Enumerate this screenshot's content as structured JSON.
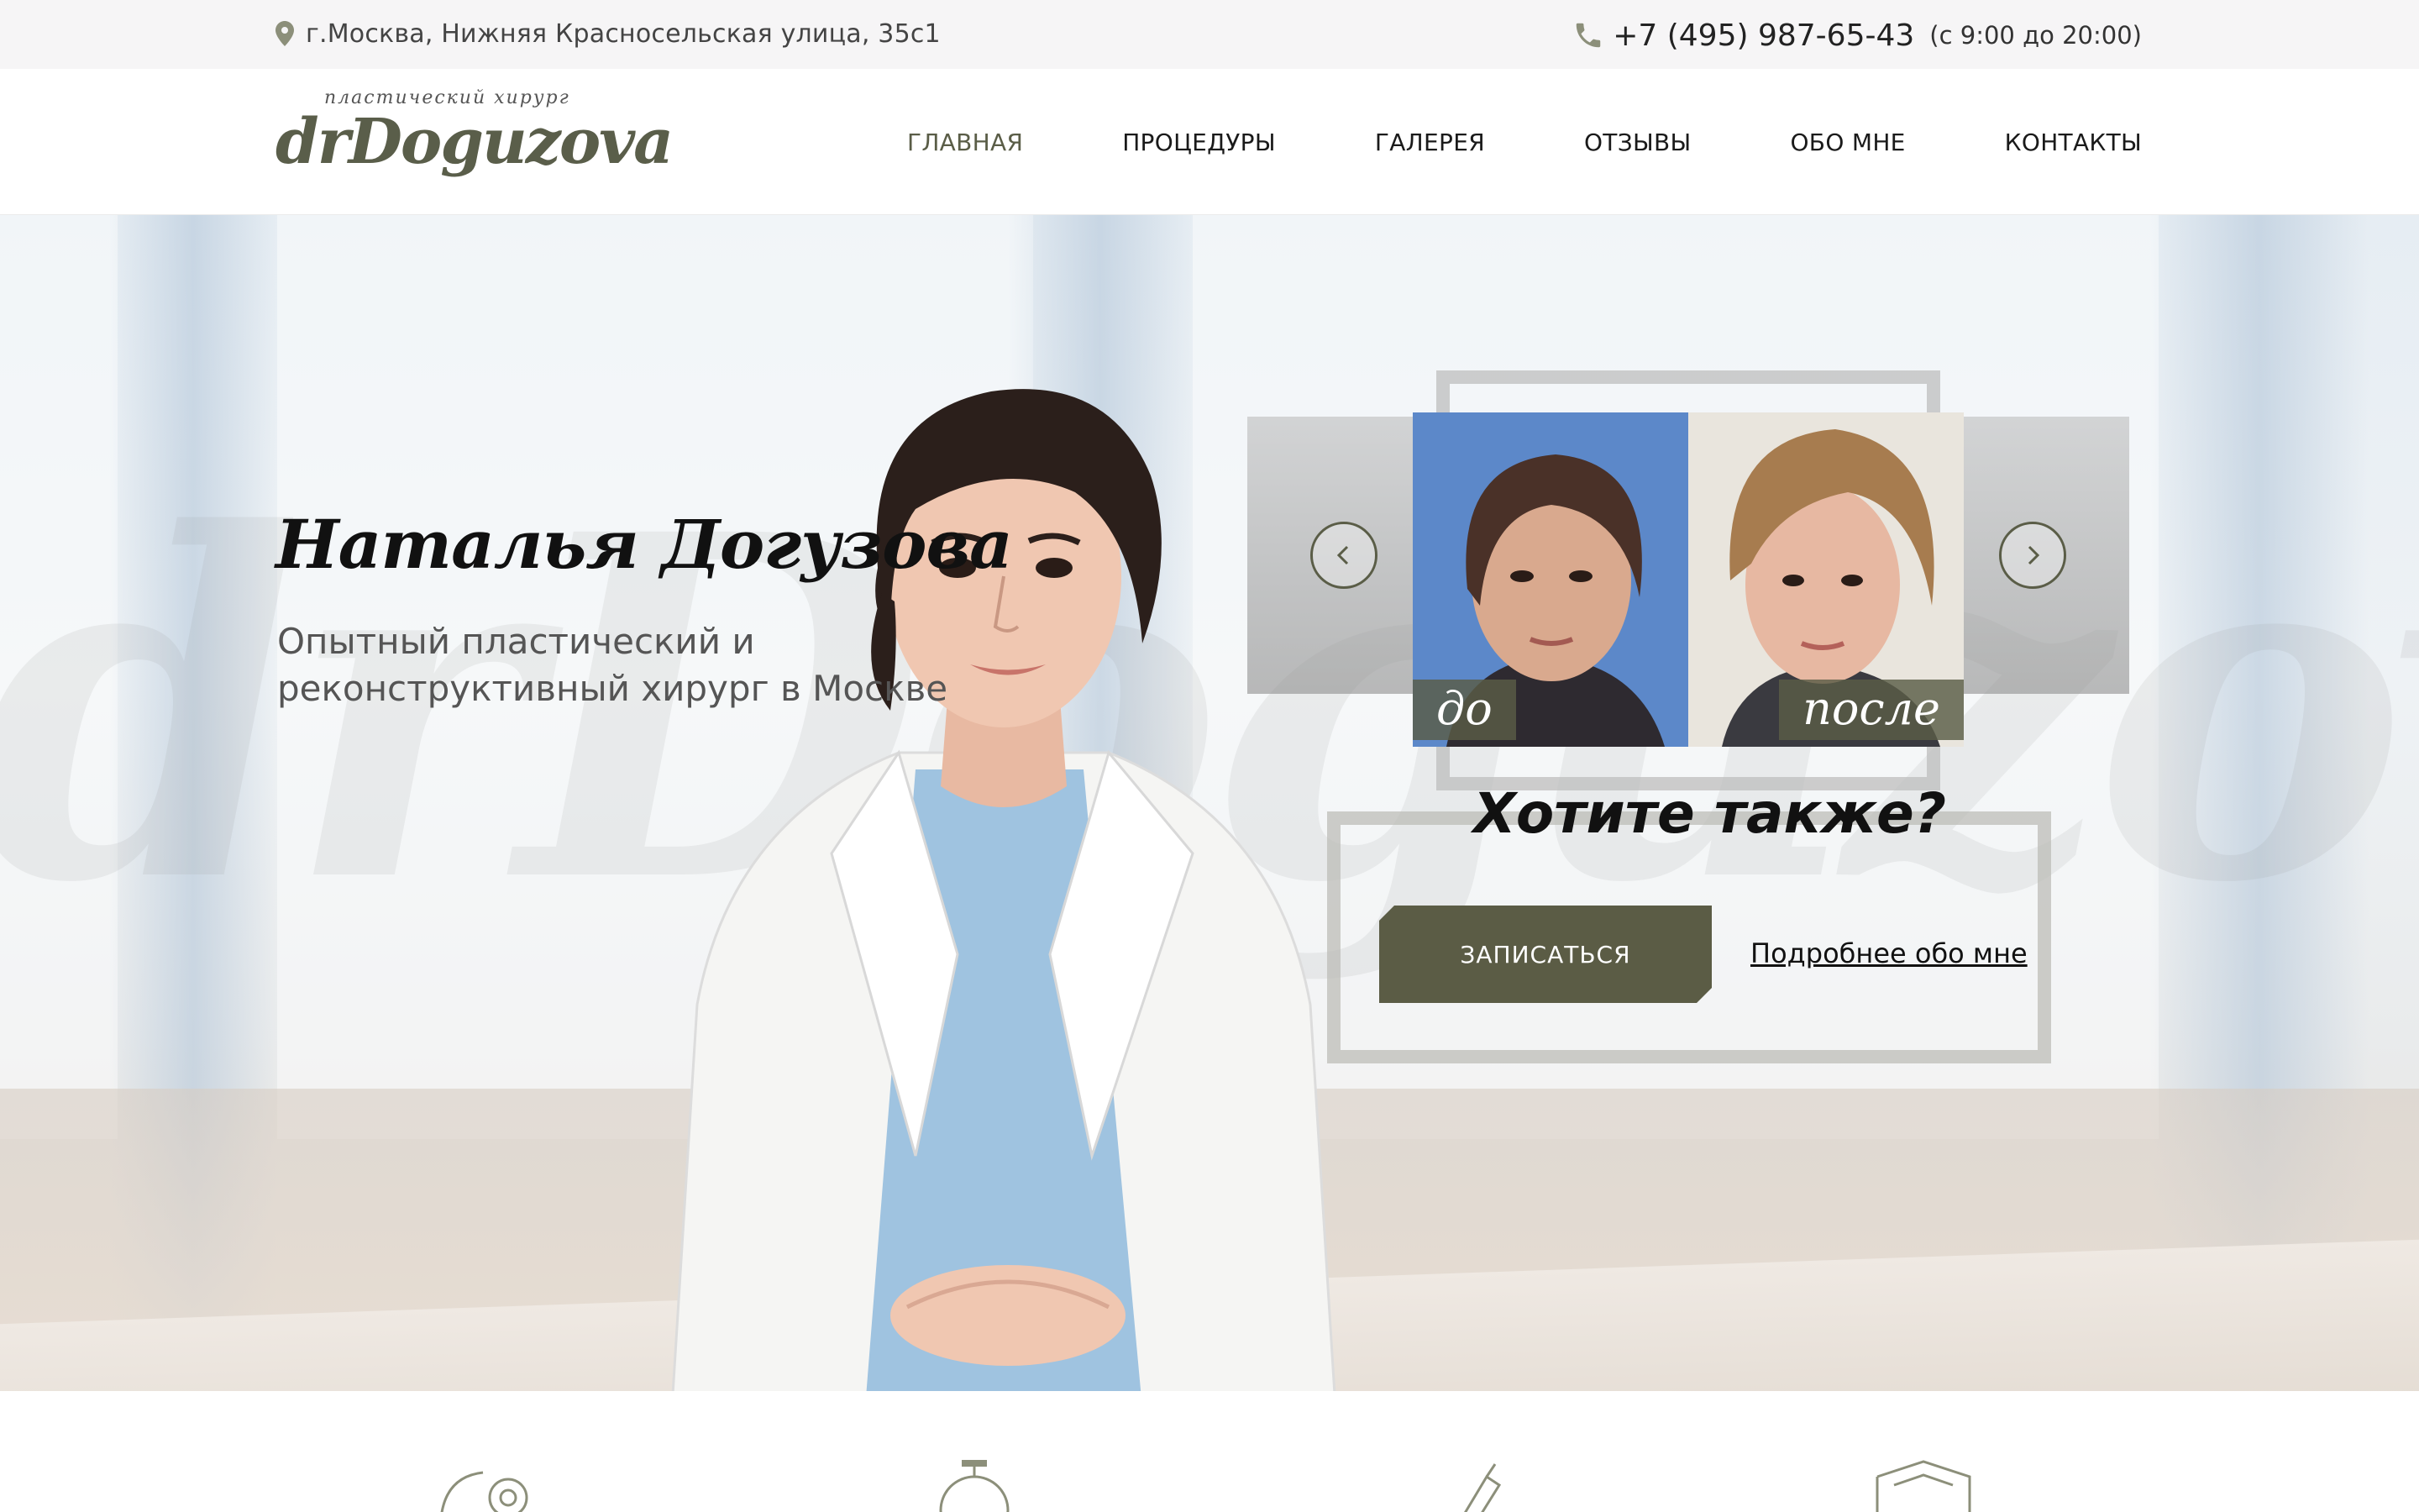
{
  "topbar": {
    "address": "г.Москва, Нижняя Красносельская улица, 35с1",
    "phone": "+7 (495) 987-65-43",
    "hours": "(с 9:00 до 20:00)"
  },
  "logo": {
    "subtitle": "пластический хирург",
    "name": "drDoguzova"
  },
  "nav": {
    "items": [
      {
        "label": "ГЛАВНАЯ",
        "active": true
      },
      {
        "label": "ПРОЦЕДУРЫ",
        "active": false
      },
      {
        "label": "ГАЛЕРЕЯ",
        "active": false
      },
      {
        "label": "ОТЗЫВЫ",
        "active": false
      },
      {
        "label": "ОБО МНЕ",
        "active": false
      },
      {
        "label": "КОНТАКТЫ",
        "active": false
      }
    ]
  },
  "hero": {
    "title": "Наталья Догузова",
    "subtitle": "Опытный пластический и реконструктивный хирург в Москве",
    "watermark": "drDoguzova"
  },
  "slider": {
    "before_label": "до",
    "after_label": "после",
    "prev_icon": "chevron-left-icon",
    "next_icon": "chevron-right-icon"
  },
  "cta": {
    "question": "Хотите также?",
    "button": "ЗАПИСАТЬСЯ",
    "link": "Подробнее обо мне"
  },
  "colors": {
    "accent": "#5a5d47",
    "topbar_bg": "#f6f5f6",
    "button_bg": "#5b5c45"
  },
  "bottom_icons": [
    "gear-hand-icon",
    "stopwatch-icon",
    "syringe-icon",
    "shield-icon"
  ]
}
